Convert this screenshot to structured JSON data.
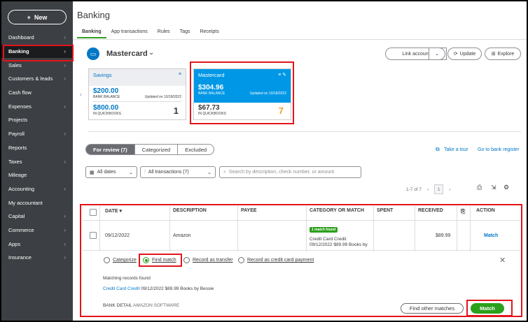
{
  "sidebar": {
    "new_label": "New",
    "items": [
      {
        "label": "Dashboard",
        "chevron": true
      },
      {
        "label": "Banking",
        "chevron": true,
        "active": true
      },
      {
        "label": "Sales",
        "chevron": true
      },
      {
        "label": "Customers & leads",
        "chevron": true
      },
      {
        "label": "Cash flow",
        "chevron": false
      },
      {
        "label": "Expenses",
        "chevron": true
      },
      {
        "label": "Projects",
        "chevron": false
      },
      {
        "label": "Payroll",
        "chevron": true
      },
      {
        "label": "Reports",
        "chevron": false
      },
      {
        "label": "Taxes",
        "chevron": true
      },
      {
        "label": "Mileage",
        "chevron": false
      },
      {
        "label": "Accounting",
        "chevron": true
      },
      {
        "label": "My accountant",
        "chevron": false
      },
      {
        "label": "Capital",
        "chevron": true
      },
      {
        "label": "Commerce",
        "chevron": true
      },
      {
        "label": "Apps",
        "chevron": true
      },
      {
        "label": "Insurance",
        "chevron": true
      }
    ]
  },
  "header": {
    "title": "Banking",
    "tabs": [
      "Banking",
      "App transactions",
      "Rules",
      "Tags",
      "Receipts"
    ]
  },
  "account": {
    "name": "Mastercard",
    "link_account": "Link account",
    "update": "Update",
    "explore": "Explore"
  },
  "cards": {
    "savings": {
      "name": "Savings",
      "bank_amount": "$200.00",
      "bank_label": "BANK BALANCE",
      "updated": "Updated on 10/18/2022",
      "qb_amount": "$800.00",
      "qb_label": "IN QUICKBOOKS",
      "count": "1"
    },
    "mastercard": {
      "name": "Mastercard",
      "bank_amount": "$304.96",
      "bank_label": "BANK BALANCE",
      "updated": "Updated on 10/18/2022",
      "qb_amount": "$67.73",
      "qb_label": "IN QUICKBOOKS",
      "count": "7"
    }
  },
  "review_tabs": {
    "for_review": "For review (7)",
    "categorized": "Categorized",
    "excluded": "Excluded"
  },
  "links": {
    "take_tour": "Take a tour",
    "go_to_bank": "Go to bank register"
  },
  "filters": {
    "dates": "All dates",
    "transactions": "All transactions (7)",
    "search_placeholder": "Search by description, check number, or amount"
  },
  "pager": {
    "range": "1-7 of 7",
    "page": "1"
  },
  "table": {
    "headers": {
      "date": "DATE",
      "description": "DESCRIPTION",
      "payee": "PAYEE",
      "category": "CATEGORY OR MATCH",
      "spent": "SPENT",
      "received": "RECEIVED",
      "action": "ACTION"
    },
    "row": {
      "date": "09/12/2022",
      "description": "Amazon",
      "badge": "1 match found",
      "category_line1": "Credit Card Credit",
      "category_line2": "09/12/2022 $89.99 Books by",
      "received": "$89.99",
      "action": "Match"
    }
  },
  "options": {
    "categorize": "Categorize",
    "find_match": "Find match",
    "record_transfer": "Record as transfer",
    "record_cc_payment": "Record as credit card payment"
  },
  "match_panel": {
    "records_found": "Matching records found",
    "record_link": "Credit Card Credit",
    "record_detail": "09/12/2022 $89.99 Books by Bessie",
    "bank_detail_label": "BANK DETAIL",
    "bank_detail_value": "AMAZON SOFTWARE",
    "find_other": "Find other matches",
    "match_btn": "Match"
  },
  "colors": {
    "accent_green": "#2ca01c",
    "link_blue": "#0077c5",
    "highlight_red": "#e3141b",
    "sidebar_bg": "#3c3f43"
  }
}
